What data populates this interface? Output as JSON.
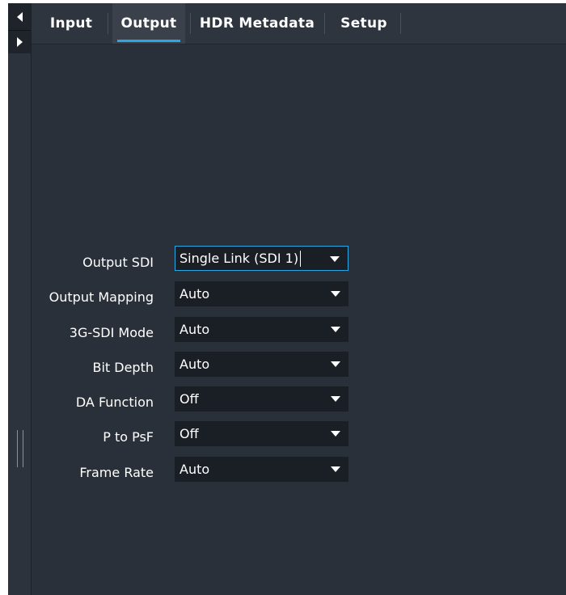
{
  "tabs": [
    {
      "label": "Input",
      "active": false
    },
    {
      "label": "Output",
      "active": true
    },
    {
      "label": "HDR Metadata",
      "active": false
    },
    {
      "label": "Setup",
      "active": false
    }
  ],
  "form": {
    "rows": [
      {
        "label": "Output SDI",
        "value": "Single Link (SDI 1)",
        "focused": true
      },
      {
        "label": "Output Mapping",
        "value": "Auto"
      },
      {
        "label": "3G-SDI Mode",
        "value": "Auto"
      },
      {
        "label": "Bit Depth",
        "value": "Auto"
      },
      {
        "label": "DA Function",
        "value": "Off"
      },
      {
        "label": "P to PsF",
        "value": "Off"
      },
      {
        "label": "Frame Rate",
        "value": "Auto"
      }
    ]
  },
  "colors": {
    "background": "#2a3039",
    "accent": "#28a8e6",
    "dropdown": "#1a1e25"
  },
  "icons": {
    "collapse": "triangle-left-icon",
    "expand": "triangle-right-icon",
    "grip": "resize-grip-icon",
    "dropdown": "caret-down-icon"
  }
}
